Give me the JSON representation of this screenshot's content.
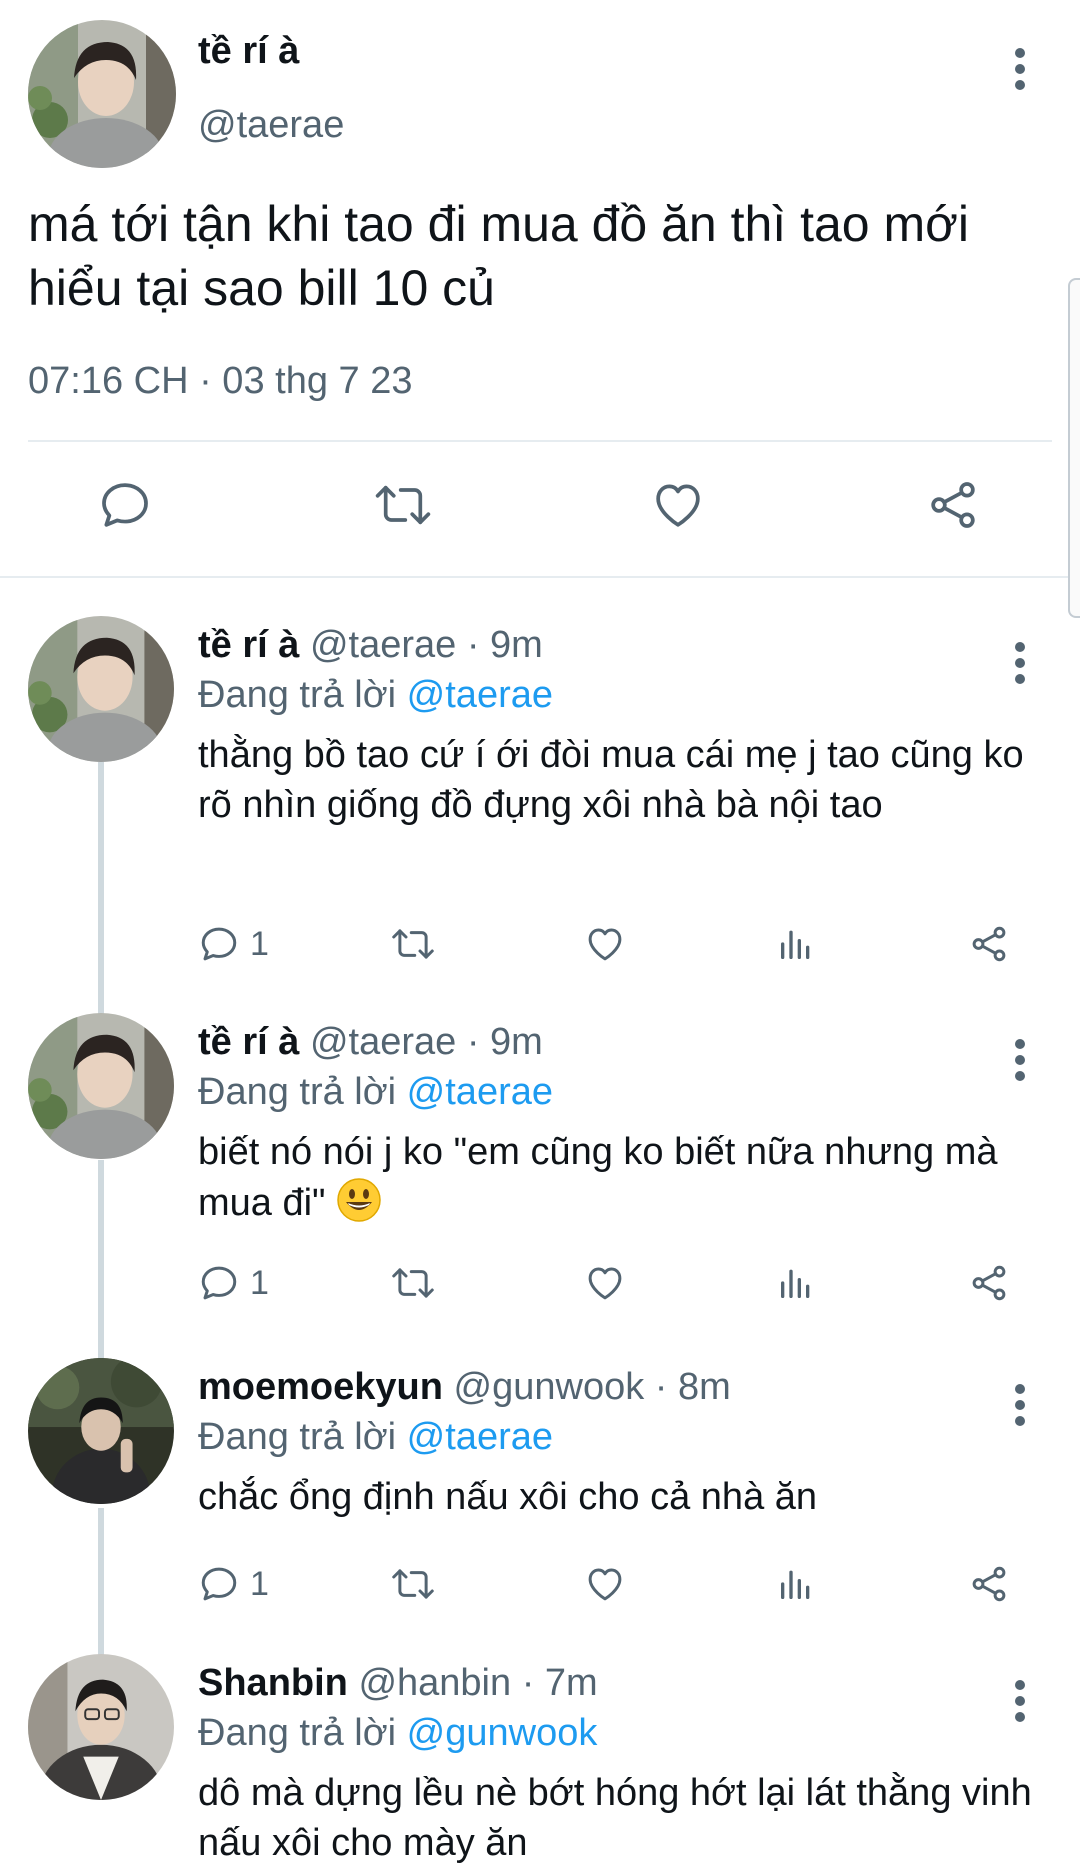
{
  "main": {
    "name": "tề rí à",
    "handle": "@taerae",
    "text": "má tới tận khi tao đi mua đồ ăn thì tao mới hiểu tại sao bill 10 củ",
    "timestamp": "07:16 CH · 03 thg 7 23",
    "actions": [
      "reply-icon",
      "retweet-icon",
      "like-icon",
      "share-icon"
    ]
  },
  "replies": [
    {
      "name": "tề rí à",
      "meta": " @taerae · 9m",
      "replying_prefix": "Đang trả lời ",
      "replying_to": "@taerae",
      "text": "thằng bồ tao cứ í ới đòi mua cái mẹ j tao cũng ko rõ nhìn giống đồ đựng xôi nhà bà nội tao",
      "reply_count": "1"
    },
    {
      "name": "tề rí à",
      "meta": " @taerae · 9m",
      "replying_prefix": "Đang trả lời ",
      "replying_to": "@taerae",
      "text": "biết nó nói j ko \"em cũng ko biết nữa nhưng mà mua đi\"",
      "emoji": "grinning-face-emoji",
      "reply_count": "1"
    },
    {
      "name": "moemoekyun",
      "meta": " @gunwook · 8m",
      "replying_prefix": "Đang trả lời ",
      "replying_to": "@taerae",
      "text": "chắc ổng định nấu xôi cho cả nhà ăn",
      "reply_count": "1"
    },
    {
      "name": "Shanbin",
      "meta": " @hanbin · 7m",
      "replying_prefix": "Đang trả lời ",
      "replying_to": "@gunwook",
      "text": "dô mà dựng lều nè bớt hóng hớt lại lát thằng vinh nấu xôi cho mày ăn"
    }
  ],
  "colors": {
    "text": "#0f1419",
    "secondary": "#536471",
    "accent": "#1d9bf0",
    "divider": "#e6ecf0",
    "thread_line": "#cfd9de"
  }
}
